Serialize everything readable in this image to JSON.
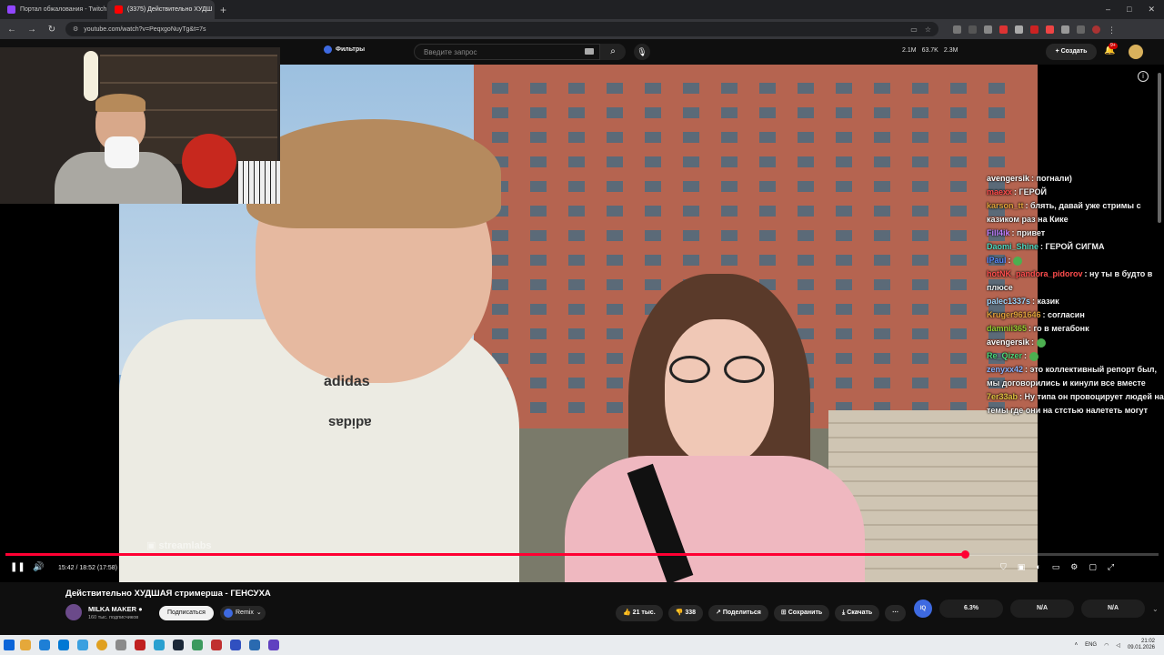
{
  "browser": {
    "tabs": [
      {
        "title": "Портал обжалования - Twitch",
        "active": false,
        "color": "#9146ff"
      },
      {
        "title": "(3375) Действительно ХУДШ",
        "active": true,
        "color": "#ff0000"
      }
    ],
    "new_tab": "+",
    "window_controls": [
      "–",
      "□",
      "✕"
    ],
    "url": "youtube.com/watch?v=PeqxgoNuyTg&t=7s"
  },
  "yt_header": {
    "filters_label": "Фильтры",
    "search_placeholder": "Введите запрос",
    "stats": [
      "2.1M",
      "63.7K",
      "2.3M"
    ],
    "create_label": "Создать",
    "notifications_badge": "9+"
  },
  "video": {
    "watermark": "streamlabs",
    "shirt_text": "adidas",
    "current_time": "15:42 / 18:52 (17:58)",
    "progress_fraction": 0.832
  },
  "chat": [
    {
      "user": "avengersik",
      "color": "#ffffff",
      "text": "погнали)"
    },
    {
      "user": "maexx",
      "color": "#ff4d4d",
      "text": "ГЕРОЙ"
    },
    {
      "user": "karson_tt",
      "color": "#e0a23b",
      "text": "блять, давай уже стримы с казиком раз на Кике"
    },
    {
      "user": "Fill4ik",
      "color": "#c080ff",
      "text": "привет"
    },
    {
      "user": "Daomi_Shine",
      "color": "#4dd9c0",
      "text": "ГЕРОЙ СИГМА"
    },
    {
      "user": "IPaul",
      "color": "#5a8cff",
      "text": ""
    },
    {
      "user": "hotNK_pandora_pidorov",
      "color": "#ff4d4d",
      "text": "ну ты в будто в плюсе"
    },
    {
      "user": "palec1337s",
      "color": "#9fd8ff",
      "text": "казик"
    },
    {
      "user": "Kruger961646",
      "color": "#e0a23b",
      "text": "согласин"
    },
    {
      "user": "damnii365",
      "color": "#9acd32",
      "text": "го в мегабонк"
    },
    {
      "user": "avengersik",
      "color": "#ffffff",
      "text": ""
    },
    {
      "user": "Re_Qizer",
      "color": "#4dd97a",
      "text": ""
    },
    {
      "user": "zenyxx42",
      "color": "#8ab4ff",
      "text": "это коллективный репорт был, мы договорились и кинули все вместе"
    },
    {
      "user": "7er33ab",
      "color": "#e0c040",
      "text": "Ну типа он провоцирует людей на темы где они на стстью налететь могут"
    }
  ],
  "below": {
    "title": "Действительно ХУДШАЯ стримерша - ГЕНСУХА",
    "channel_name": "MILKA MAKER",
    "subscribers": "160 тыс. подписчиков",
    "subscribe_label": "Подписаться",
    "remix_label": "Remix",
    "likes": "21 тыс.",
    "dislikes": "338",
    "share_label": "Поделиться",
    "save_label": "Сохранить",
    "download_label": "Скачать",
    "more_label": "···",
    "ext_logo": "IQ",
    "ext_stats": [
      "6.3%",
      "N/A",
      "N/A"
    ]
  },
  "taskbar": {
    "lang": "ENG",
    "time": "21:02",
    "date": "09.01.2026"
  },
  "colors": {
    "accent": "#ff0033",
    "bg": "#0f0f0f"
  }
}
